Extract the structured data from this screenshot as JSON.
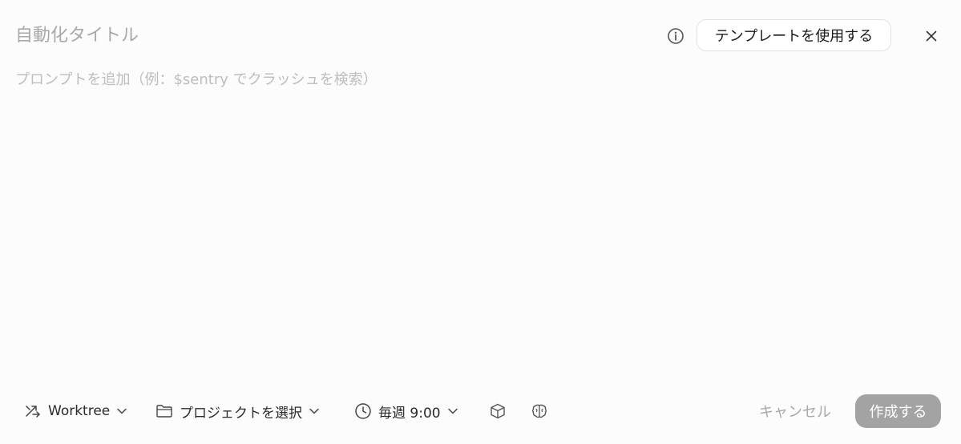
{
  "header": {
    "title_placeholder": "自動化タイトル",
    "info_icon": "info-circle-icon",
    "template_button_label": "テンプレートを使用する",
    "close_icon": "close-x-icon"
  },
  "prompt": {
    "placeholder": "プロンプトを追加（例：$sentry でクラッシュを検索）"
  },
  "toolbar": {
    "worktree": {
      "icon": "branch-arrow-icon",
      "label": "Worktree"
    },
    "project": {
      "icon": "folder-icon",
      "label": "プロジェクトを選択"
    },
    "schedule": {
      "icon": "clock-icon",
      "label": "毎週 9:00"
    },
    "cube_icon": "cube-icon",
    "brain_icon": "brain-icon"
  },
  "footer": {
    "cancel_label": "キャンセル",
    "create_label": "作成する"
  },
  "colors": {
    "background": "#fdfcfd",
    "create_button_bg": "#a3a3a3",
    "muted_text": "#a8a8a8"
  }
}
